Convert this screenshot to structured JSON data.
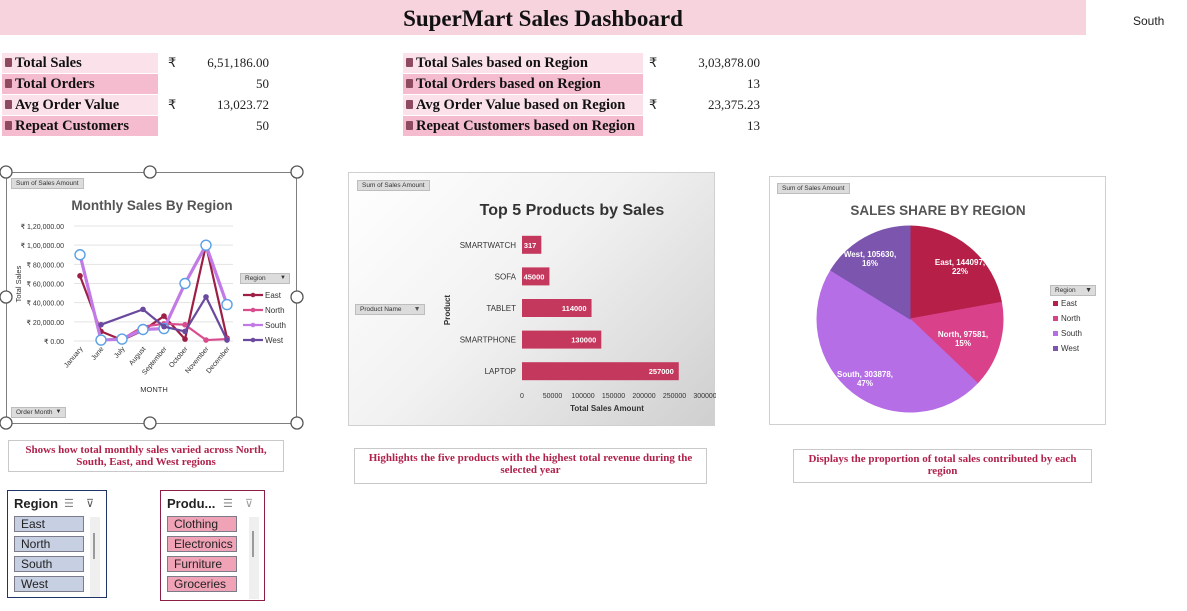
{
  "header": {
    "title": "SuperMart Sales Dashboard",
    "selected_region": "South"
  },
  "kpis_overall": [
    {
      "label": "Total Sales",
      "currency": "₹",
      "value": "6,51,186.00"
    },
    {
      "label": "Total Orders",
      "currency": "",
      "value": "50"
    },
    {
      "label": "Avg Order Value",
      "currency": "₹",
      "value": "13,023.72"
    },
    {
      "label": "Repeat Customers",
      "currency": "",
      "value": "50"
    }
  ],
  "kpis_region": [
    {
      "label": "Total Sales based on Region",
      "currency": "₹",
      "value": "3,03,878.00"
    },
    {
      "label": "Total Orders based on Region",
      "currency": "",
      "value": "13"
    },
    {
      "label": "Avg Order Value based on Region",
      "currency": "₹",
      "value": "23,375.23"
    },
    {
      "label": "Repeat Customers based on Region",
      "currency": "",
      "value": "13"
    }
  ],
  "chart_data": [
    {
      "type": "line",
      "title": "Monthly Sales By Region",
      "field_button": "Sum of Sales Amount",
      "axis_field_button": "Order Month",
      "xlabel": "MONTH",
      "ylabel": "Total Sales",
      "categories": [
        "January",
        "June",
        "July",
        "August",
        "September",
        "October",
        "November",
        "December"
      ],
      "y_ticks": [
        "₹ 0.00",
        "₹ 20,000.00",
        "₹ 40,000.00",
        "₹ 60,000.00",
        "₹ 80,000.00",
        "₹ 1,00,000.00",
        "₹ 1,20,000.00"
      ],
      "ylim": [
        0,
        120000
      ],
      "grid": true,
      "legend_title": "Region",
      "legend_position": "right",
      "series": [
        {
          "name": "East",
          "color": "#9e1f45",
          "values": [
            68000,
            10000,
            1000,
            11000,
            26000,
            2000,
            100000,
            3000
          ]
        },
        {
          "name": "North",
          "color": "#d94d8f",
          "values": [
            null,
            1000,
            2000,
            15000,
            18000,
            17000,
            1000,
            2000
          ]
        },
        {
          "name": "South",
          "color": "#c27ae6",
          "values": [
            90000,
            1000,
            2000,
            12000,
            13000,
            60000,
            100000,
            38000
          ]
        },
        {
          "name": "West",
          "color": "#6a4a9e",
          "values": [
            null,
            17000,
            null,
            33000,
            15000,
            10000,
            46000,
            1000
          ]
        }
      ]
    },
    {
      "type": "bar",
      "title": "Top 5 Products by Sales",
      "field_button": "Sum of Sales Amount",
      "axis_field_button": "Product Name",
      "xlabel": "Total Sales Amount",
      "ylabel": "Product",
      "categories": [
        "SMARTWATCH",
        "SOFA",
        "TABLET",
        "SMARTPHONE",
        "LAPTOP"
      ],
      "values": [
        31700,
        45000,
        114000,
        130000,
        257000
      ],
      "data_labels": [
        "317",
        "45000",
        "114000",
        "130000",
        "257000"
      ],
      "x_ticks": [
        "0",
        "50000",
        "100000",
        "150000",
        "200000",
        "250000",
        "300000"
      ],
      "xlim": [
        0,
        300000
      ],
      "bar_color": "#c5385e"
    },
    {
      "type": "pie",
      "title": "SALES SHARE BY REGION",
      "field_button": "Sum of Sales Amount",
      "legend_title": "Region",
      "legend_position": "right",
      "slices": [
        {
          "name": "East",
          "value": 144097,
          "label": "East, 144097,",
          "pct_label": "22%",
          "color": "#b51f48"
        },
        {
          "name": "North",
          "value": 97581,
          "label": "North, 97581,",
          "pct_label": "15%",
          "color": "#d9428a"
        },
        {
          "name": "South",
          "value": 303878,
          "label": "South, 303878,",
          "pct_label": "47%",
          "color": "#b56ee6"
        },
        {
          "name": "West",
          "value": 105630,
          "label": "West, 105630,",
          "pct_label": "16%",
          "color": "#7b55ae"
        }
      ]
    }
  ],
  "descriptions": {
    "monthly": "Shows how total monthly sales varied across North, South, East, and West regions",
    "products": "Highlights the five products with the highest total revenue during the selected year",
    "share": "Displays the proportion of total sales contributed by each region"
  },
  "slicers": {
    "region": {
      "title": "Region",
      "items": [
        "East",
        "North",
        "South",
        "West"
      ],
      "item_color": "#c7cfe3",
      "border": "#1f3566"
    },
    "product": {
      "title": "Produ...",
      "items": [
        "Clothing",
        "Electronics",
        "Furniture",
        "Groceries"
      ],
      "item_color": "#f0a3b7",
      "border": "#8e1d45"
    }
  }
}
